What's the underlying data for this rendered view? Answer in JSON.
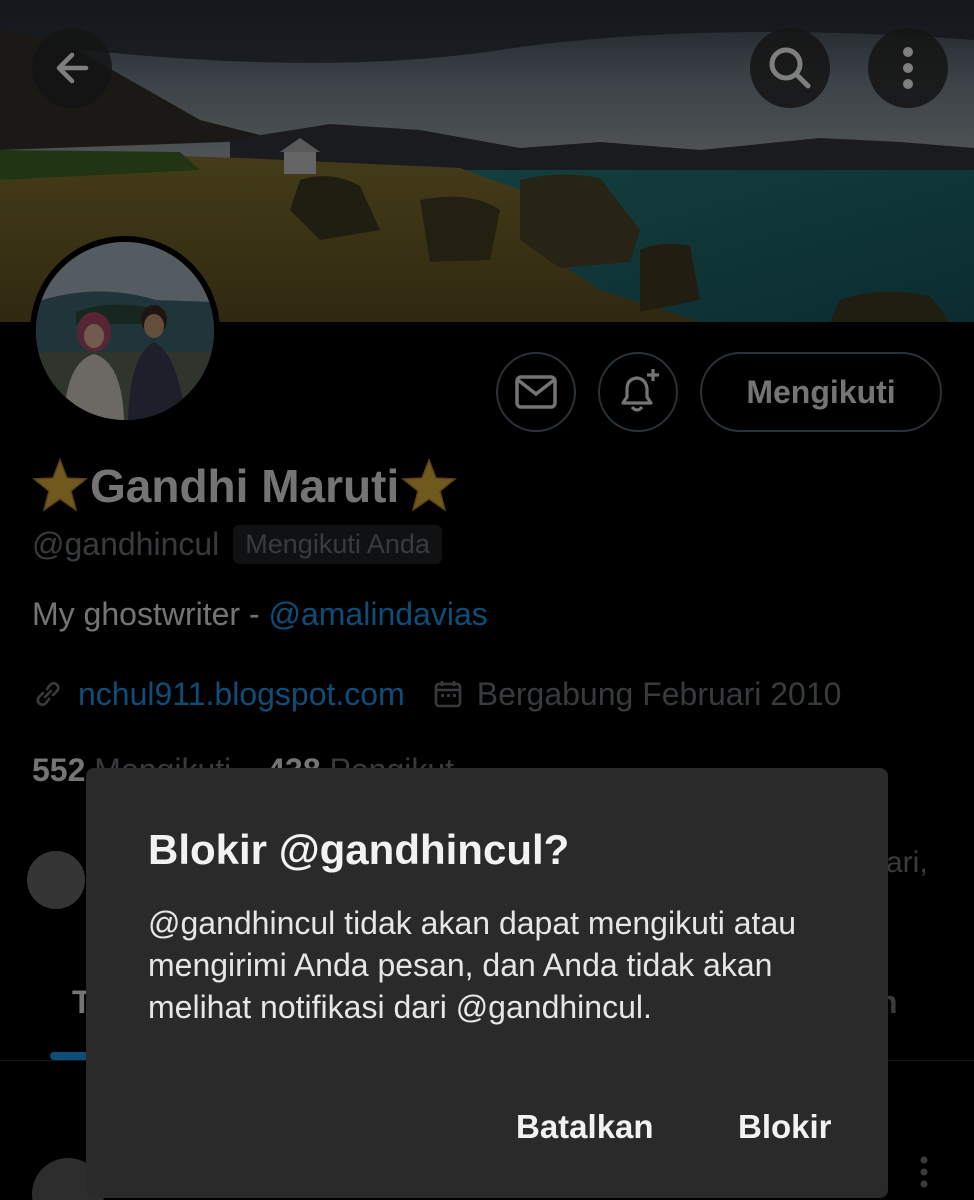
{
  "profile": {
    "name": "Gandhi Maruti",
    "handle": "@gandhincul",
    "follows_you": "Mengikuti Anda",
    "bio_prefix": "My ghostwriter - ",
    "bio_mention": "@amalindavias",
    "website": "nchul911.blogspot.com",
    "joined": "Bergabung Februari 2010",
    "following_count": "552",
    "following_label": "Mengikuti",
    "followers_count": "438",
    "followers_label": "Pengikut",
    "follow_button": "Mengikuti"
  },
  "background_fragments": {
    "followers_you_know_tail": "ari,",
    "tab_left": "T",
    "tab_right": "n"
  },
  "icons": {
    "back": "arrow-left-icon",
    "search": "search-icon",
    "more": "more-vertical-icon",
    "message": "mail-icon",
    "notify": "bell-plus-icon",
    "link": "link-icon",
    "calendar": "calendar-icon",
    "star": "star-icon"
  },
  "dialog": {
    "title": "Blokir @gandhincul?",
    "body": "@gandhincul tidak akan dapat mengikuti atau mengirimi Anda pesan, dan Anda tidak akan melihat notifikasi dari @gandhincul.",
    "cancel_label": "Batalkan",
    "confirm_label": "Blokir"
  },
  "colors": {
    "accent": "#1d9bf0",
    "background": "#000000",
    "dialog_bg": "#2a2a2a",
    "muted_text": "#71767b"
  }
}
